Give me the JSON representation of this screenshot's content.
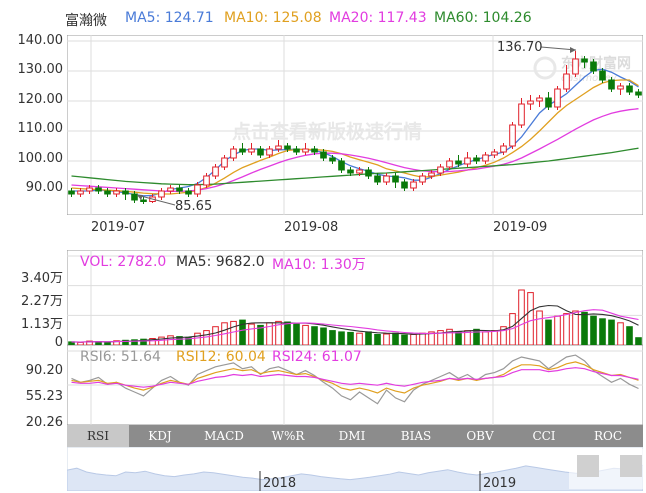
{
  "stock_name": "富瀚微",
  "main_legend": [
    {
      "label": "MA5: 124.71",
      "color": "#4a7bd8"
    },
    {
      "label": "MA10: 125.08",
      "color": "#e0a020"
    },
    {
      "label": "MA20: 117.43",
      "color": "#e23ce0"
    },
    {
      "label": "MA60: 104.26",
      "color": "#2e8b2e"
    }
  ],
  "price_axis": [
    "140.00",
    "130.00",
    "120.00",
    "110.00",
    "100.00",
    "90.00"
  ],
  "date_axis": [
    "2019-07",
    "2019-08",
    "2019-09"
  ],
  "high_marker": "136.70",
  "low_marker": "85.65",
  "watermark": {
    "logo": "东方财富网",
    "sub": "eastmoney",
    "promo": "点击查看新版极速行情"
  },
  "vol_axis": [
    "3.40万",
    "2.27万",
    "1.13万",
    "0"
  ],
  "vol_legend": [
    {
      "label": "VOL: 2782.0",
      "color": "#e23ce0"
    },
    {
      "label": "MA5: 9682.0",
      "color": "#333333"
    },
    {
      "label": "MA10: 1.30万",
      "color": "#e23ce0"
    }
  ],
  "rsi_axis": [
    "90.20",
    "55.23",
    "20.26"
  ],
  "rsi_legend": [
    {
      "label": "RSI6: 51.64",
      "color": "#999999"
    },
    {
      "label": "RSI12: 60.04",
      "color": "#e0a020"
    },
    {
      "label": "RSI24: 61.07",
      "color": "#e23ce0"
    }
  ],
  "tabs": [
    "RSI",
    "KDJ",
    "MACD",
    "W%R",
    "DMI",
    "BIAS",
    "OBV",
    "CCI",
    "ROC"
  ],
  "active_tab": "RSI",
  "overview_years": [
    "2018",
    "2019"
  ],
  "colors": {
    "up": "#e0202a",
    "down": "#0a7a0a",
    "grid": "#dddddd",
    "axis": "#999999"
  },
  "chart_data": {
    "type": "candlestick",
    "ylim": [
      82,
      142
    ],
    "ma_lines": [
      "MA5",
      "MA10",
      "MA20",
      "MA60"
    ],
    "candles": [
      [
        90,
        89,
        91,
        88
      ],
      [
        89,
        90,
        91,
        88
      ],
      [
        90,
        91,
        92,
        89
      ],
      [
        91,
        90,
        92,
        89
      ],
      [
        90,
        89,
        91,
        88
      ],
      [
        89,
        90,
        91,
        88
      ],
      [
        90,
        89,
        91,
        87
      ],
      [
        89,
        87,
        90,
        86
      ],
      [
        87,
        86.5,
        88,
        85.65
      ],
      [
        86.5,
        88,
        89,
        86
      ],
      [
        88,
        90,
        91,
        87
      ],
      [
        90,
        91,
        92,
        89
      ],
      [
        91,
        90,
        92,
        89
      ],
      [
        90,
        89,
        91,
        88
      ],
      [
        89,
        92,
        93,
        88
      ],
      [
        92,
        95,
        96,
        91
      ],
      [
        95,
        98,
        99,
        94
      ],
      [
        98,
        101,
        102,
        97
      ],
      [
        101,
        104,
        105,
        100
      ],
      [
        104,
        103,
        106,
        102
      ],
      [
        103,
        104,
        106,
        102
      ],
      [
        104,
        102,
        105,
        101
      ],
      [
        102,
        104,
        105,
        101
      ],
      [
        104,
        105,
        107,
        103
      ],
      [
        105,
        104,
        106,
        103
      ],
      [
        104,
        103,
        105,
        102
      ],
      [
        103,
        104,
        106,
        102
      ],
      [
        104,
        103,
        105,
        102
      ],
      [
        103,
        101,
        104,
        100
      ],
      [
        101,
        100,
        102,
        99
      ],
      [
        100,
        97,
        101,
        96
      ],
      [
        97,
        96,
        98,
        95
      ],
      [
        96,
        97,
        98,
        95
      ],
      [
        97,
        95,
        98,
        94
      ],
      [
        95,
        93,
        96,
        92
      ],
      [
        93,
        95,
        96,
        92
      ],
      [
        95,
        93,
        96,
        91
      ],
      [
        93,
        91,
        94,
        90
      ],
      [
        91,
        93,
        94,
        90
      ],
      [
        93,
        95,
        96,
        92
      ],
      [
        95,
        96,
        97,
        94
      ],
      [
        96,
        98,
        99,
        95
      ],
      [
        98,
        100,
        101,
        97
      ],
      [
        100,
        99,
        102,
        98
      ],
      [
        99,
        101,
        103,
        98
      ],
      [
        101,
        100,
        102,
        99
      ],
      [
        100,
        102,
        103,
        99
      ],
      [
        102,
        103,
        104,
        101
      ],
      [
        103,
        105,
        106,
        102
      ],
      [
        105,
        112,
        113,
        104
      ],
      [
        112,
        119,
        121,
        111
      ],
      [
        119,
        120,
        122,
        117
      ],
      [
        120,
        121,
        122,
        118
      ],
      [
        121,
        118,
        123,
        117
      ],
      [
        118,
        124,
        125,
        117
      ],
      [
        124,
        129,
        132,
        123
      ],
      [
        129,
        134,
        136.7,
        128
      ],
      [
        134,
        133,
        135,
        131
      ],
      [
        133,
        130,
        134,
        129
      ],
      [
        130,
        127,
        131,
        126
      ],
      [
        127,
        124,
        128,
        123
      ],
      [
        124,
        125,
        126,
        122
      ],
      [
        125,
        123,
        126,
        122
      ],
      [
        123,
        122,
        124,
        121
      ]
    ],
    "ma": {
      "MA5": [
        90,
        90,
        90,
        90.3,
        90.2,
        89.8,
        89.4,
        88.8,
        88.4,
        88.5,
        89.4,
        90.5,
        91,
        91.5,
        92.5,
        94.5,
        97,
        100,
        102,
        103.5,
        104,
        104,
        103.5,
        103.7,
        103.8,
        104,
        103.8,
        103.5,
        102.8,
        101.5,
        99.8,
        98.4,
        97.4,
        96.6,
        95.6,
        95,
        94.8,
        94.4,
        93.6,
        93.6,
        94.6,
        95.8,
        97.2,
        98.4,
        99.6,
        100.4,
        101.4,
        102.2,
        103,
        105,
        108,
        112,
        116,
        118.6,
        120.4,
        122.4,
        125.2,
        128,
        130.2,
        130.6,
        129.6,
        128,
        126.6,
        124.7
      ],
      "MA10": [
        91,
        90.8,
        90.6,
        90.5,
        90.3,
        90.1,
        89.9,
        89.6,
        89.3,
        89.1,
        89,
        89,
        89.3,
        89.6,
        90.2,
        91.2,
        92.6,
        94.3,
        96.2,
        97.8,
        99,
        100.2,
        101.3,
        102.5,
        103.5,
        103.8,
        103.9,
        103.8,
        103.6,
        103.2,
        102.4,
        101.3,
        100.4,
        99.6,
        98.7,
        97.4,
        96.7,
        96,
        95.2,
        94.6,
        94.8,
        95.3,
        95.8,
        96.3,
        97,
        97.8,
        98.6,
        99.6,
        101,
        102.8,
        104.8,
        107.2,
        110,
        113,
        116,
        118.5,
        120.5,
        122.5,
        124.5,
        126,
        126.8,
        127,
        127,
        125.1
      ],
      "MA20": [
        92,
        91.8,
        91.6,
        91.4,
        91.2,
        91,
        90.8,
        90.6,
        90.4,
        90.2,
        90,
        89.9,
        89.9,
        90,
        90.3,
        90.8,
        91.5,
        92.4,
        93.5,
        94.7,
        96,
        97.2,
        98.3,
        99.4,
        100.4,
        101.2,
        101.9,
        102.4,
        102.6,
        102.6,
        102.4,
        102,
        101.5,
        100.9,
        100.2,
        99.4,
        98.6,
        97.8,
        97.2,
        96.7,
        96.5,
        96.4,
        96.5,
        96.7,
        97,
        97.3,
        97.8,
        98.3,
        98.9,
        99.8,
        101,
        102.5,
        104,
        105.6,
        107.2,
        108.9,
        110.6,
        112.2,
        113.7,
        114.9,
        115.9,
        116.6,
        117.1,
        117.43
      ],
      "MA60": [
        95,
        94.7,
        94.4,
        94.1,
        93.8,
        93.5,
        93.2,
        93,
        92.8,
        92.6,
        92.4,
        92.3,
        92.2,
        92.1,
        92.1,
        92.2,
        92.3,
        92.5,
        92.7,
        92.9,
        93.1,
        93.3,
        93.5,
        93.7,
        93.9,
        94.1,
        94.3,
        94.5,
        94.7,
        94.9,
        95.1,
        95.3,
        95.5,
        95.7,
        95.9,
        96,
        96.2,
        96.4,
        96.6,
        96.8,
        97,
        97.2,
        97.4,
        97.6,
        97.8,
        98,
        98.2,
        98.4,
        98.6,
        98.8,
        99.1,
        99.4,
        99.7,
        100,
        100.4,
        100.8,
        101.2,
        101.6,
        102,
        102.4,
        102.8,
        103.3,
        103.8,
        104.26
      ]
    },
    "volume": [
      0.12,
      0.1,
      0.15,
      0.13,
      0.11,
      0.16,
      0.18,
      0.2,
      0.22,
      0.25,
      0.3,
      0.35,
      0.32,
      0.28,
      0.45,
      0.55,
      0.7,
      0.85,
      0.9,
      0.95,
      0.8,
      0.75,
      0.85,
      0.9,
      0.88,
      0.8,
      0.75,
      0.7,
      0.65,
      0.55,
      0.5,
      0.48,
      0.45,
      0.5,
      0.4,
      0.42,
      0.45,
      0.38,
      0.4,
      0.45,
      0.5,
      0.55,
      0.6,
      0.5,
      0.55,
      0.6,
      0.5,
      0.55,
      0.7,
      1.2,
      2.1,
      2.0,
      1.3,
      0.95,
      1.1,
      1.2,
      1.3,
      1.25,
      1.1,
      1.0,
      0.95,
      0.85,
      0.7,
      0.28
    ],
    "vol_ylim": [
      0,
      3.4
    ],
    "rsi": {
      "RSI6": [
        62,
        58,
        60,
        63,
        56,
        58,
        52,
        48,
        44,
        52,
        60,
        64,
        58,
        55,
        66,
        70,
        74,
        76,
        78,
        72,
        74,
        66,
        72,
        74,
        70,
        66,
        70,
        65,
        58,
        52,
        44,
        40,
        48,
        42,
        36,
        50,
        42,
        38,
        50,
        56,
        60,
        64,
        68,
        62,
        66,
        60,
        66,
        68,
        72,
        80,
        84,
        82,
        80,
        72,
        78,
        84,
        86,
        80,
        70,
        64,
        58,
        62,
        56,
        51.64
      ],
      "RSI12": [
        60,
        58,
        59,
        60,
        57,
        58,
        55,
        52,
        50,
        53,
        57,
        60,
        58,
        56,
        62,
        65,
        68,
        70,
        72,
        70,
        71,
        67,
        69,
        70,
        68,
        66,
        67,
        64,
        60,
        57,
        52,
        50,
        52,
        50,
        47,
        52,
        49,
        47,
        52,
        55,
        57,
        59,
        62,
        60,
        62,
        60,
        62,
        63,
        66,
        72,
        76,
        76,
        75,
        71,
        73,
        77,
        79,
        76,
        71,
        68,
        65,
        66,
        63,
        60.04
      ],
      "RSI24": [
        58,
        57,
        57,
        58,
        56,
        57,
        55,
        54,
        53,
        54,
        56,
        58,
        57,
        56,
        59,
        61,
        63,
        64,
        66,
        65,
        66,
        64,
        65,
        66,
        65,
        64,
        64,
        63,
        61,
        59,
        57,
        56,
        57,
        56,
        55,
        57,
        55,
        54,
        56,
        58,
        59,
        60,
        62,
        61,
        62,
        61,
        62,
        63,
        64,
        68,
        71,
        71,
        71,
        69,
        70,
        72,
        73,
        72,
        69,
        67,
        65,
        65,
        63,
        61.07
      ]
    },
    "rsi_ylim": [
      20.26,
      90.2
    ],
    "overview": [
      0.55,
      0.6,
      0.5,
      0.45,
      0.42,
      0.4,
      0.5,
      0.48,
      0.52,
      0.45,
      0.4,
      0.38,
      0.42,
      0.45,
      0.5,
      0.48,
      0.44,
      0.4,
      0.36,
      0.34,
      0.3,
      0.32,
      0.35,
      0.4,
      0.45,
      0.42,
      0.38,
      0.35,
      0.32,
      0.3,
      0.33,
      0.36,
      0.4,
      0.44,
      0.5,
      0.46,
      0.42,
      0.48,
      0.52,
      0.56,
      0.5,
      0.45,
      0.42,
      0.46,
      0.5,
      0.55,
      0.6,
      0.66,
      0.62,
      0.58,
      0.54,
      0.5,
      0.47,
      0.45,
      0.5,
      0.55,
      0.6,
      0.58,
      0.62,
      0.68
    ]
  }
}
